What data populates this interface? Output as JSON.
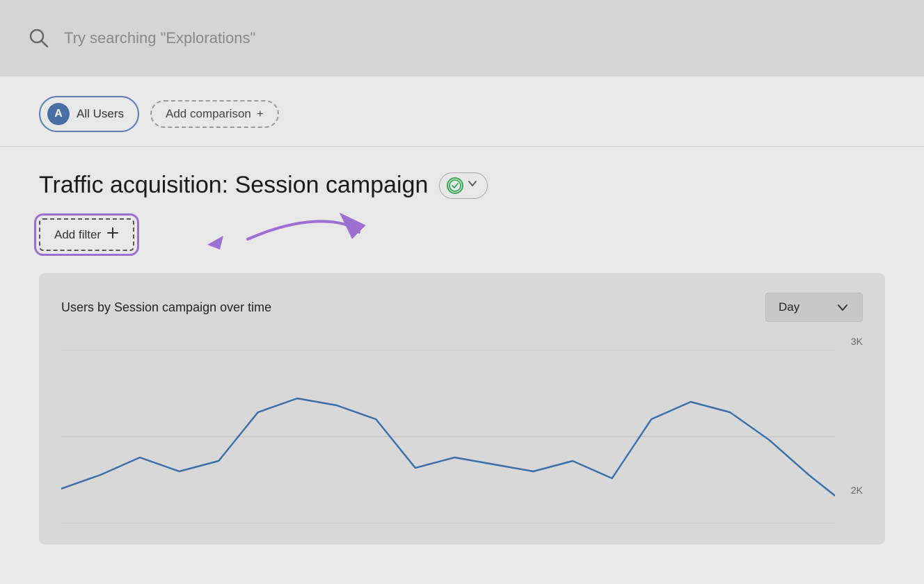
{
  "search": {
    "placeholder": "Try searching \"Explorations\""
  },
  "filter_bar": {
    "all_users_label": "All Users",
    "all_users_avatar": "A",
    "add_comparison_label": "Add comparison",
    "add_comparison_icon": "+"
  },
  "page": {
    "title": "Traffic acquisition: Session campaign",
    "status": "active",
    "add_filter_label": "Add filter",
    "add_filter_icon": "+"
  },
  "chart": {
    "title": "Users by Session campaign over time",
    "time_dropdown_label": "Day",
    "y_axis_max": "3K",
    "y_axis_mid": "2K"
  },
  "icons": {
    "search": "🔍",
    "chevron_down": "▾",
    "check": "✓",
    "plus": "+"
  }
}
